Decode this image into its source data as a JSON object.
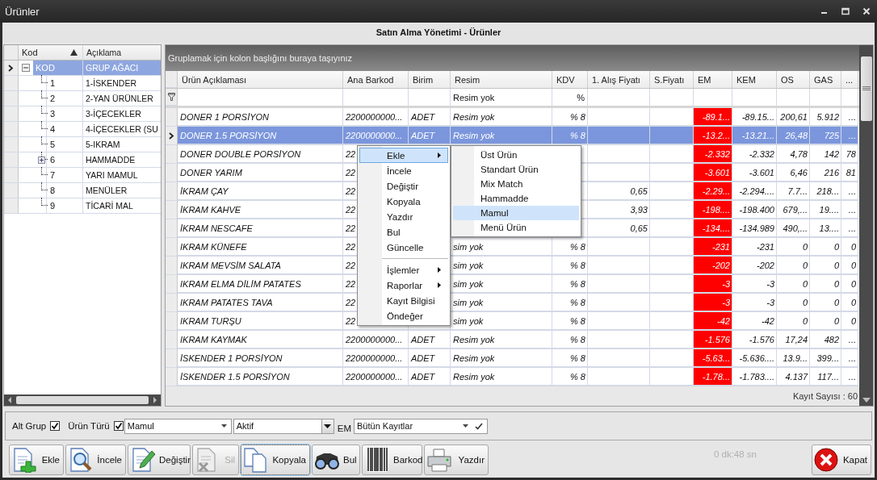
{
  "window": {
    "title": "Ürünler"
  },
  "form_title": "Satın Alma Yönetimi - Ürünler",
  "tree": {
    "columns": [
      {
        "label": "Kod",
        "sorted": true
      },
      {
        "label": "Açıklama",
        "sorted": false
      }
    ],
    "root": {
      "kod": "KOD",
      "aciklama": "GRUP AĞACI",
      "selected": true,
      "expanded": true,
      "children": [
        {
          "kod": "1",
          "aciklama": "1-İSKENDER",
          "selected": false,
          "expandable": false
        },
        {
          "kod": "2",
          "aciklama": "2-YAN ÜRÜNLER",
          "selected": false,
          "expandable": false
        },
        {
          "kod": "3",
          "aciklama": "3-İÇECEKLER",
          "selected": false,
          "expandable": false
        },
        {
          "kod": "4",
          "aciklama": "4-İÇECEKLER (SU",
          "selected": false,
          "expandable": false
        },
        {
          "kod": "5",
          "aciklama": "5-IKRAM",
          "selected": false,
          "expandable": false
        },
        {
          "kod": "6",
          "aciklama": "HAMMADDE",
          "selected": false,
          "expandable": true
        },
        {
          "kod": "7",
          "aciklama": "YARI MAMUL",
          "selected": false,
          "expandable": false
        },
        {
          "kod": "8",
          "aciklama": "MENÜLER",
          "selected": false,
          "expandable": false
        },
        {
          "kod": "9",
          "aciklama": "TİCARİ MAL",
          "selected": false,
          "expandable": false
        }
      ]
    }
  },
  "grid": {
    "group_hint": "Gruplamak için kolon başlığını buraya taşıyınız",
    "columns": [
      {
        "label": "Ürün Açıklaması",
        "kind": "text"
      },
      {
        "label": "Ana Barkod",
        "kind": "text"
      },
      {
        "label": "Birim",
        "kind": "text"
      },
      {
        "label": "Resim",
        "kind": "text",
        "filter": "Resim yok"
      },
      {
        "label": "KDV",
        "kind": "number",
        "filter": "%"
      },
      {
        "label": "1. Alış Fiyatı",
        "kind": "number"
      },
      {
        "label": "S.Fiyatı",
        "kind": "number"
      },
      {
        "label": "EM",
        "kind": "alert"
      },
      {
        "label": "KEM",
        "kind": "number"
      },
      {
        "label": "OS",
        "kind": "number"
      },
      {
        "label": "GAS",
        "kind": "number"
      },
      {
        "label": "...",
        "kind": "number"
      }
    ],
    "rows": [
      {
        "selected": false,
        "cells": [
          "DONER 1 PORSİYON",
          "2200000000...",
          "ADET",
          "Resim yok",
          "% 8",
          null,
          null,
          "-89.1...",
          "-89.15...",
          "200,61",
          "5.912",
          "..."
        ]
      },
      {
        "selected": true,
        "cells": [
          "DONER 1.5 PORSİYON",
          "2200000000...",
          "ADET",
          "Resim yok",
          "% 8",
          null,
          null,
          "-13.2...",
          "-13.21...",
          "26,48",
          "725",
          "..."
        ]
      },
      {
        "selected": false,
        "cells": [
          "DONER DOUBLE PORSİYON",
          "22",
          null,
          null,
          null,
          null,
          null,
          "-2.332",
          "-2.332",
          "4,78",
          "142",
          "78"
        ]
      },
      {
        "selected": false,
        "cells": [
          "DONER YARIM",
          "22",
          null,
          null,
          null,
          null,
          null,
          "-3.601",
          "-3.601",
          "6,46",
          "216",
          "81"
        ]
      },
      {
        "selected": false,
        "cells": [
          "İKRAM ÇAY",
          "22",
          null,
          null,
          null,
          "0,65",
          null,
          "-2.29...",
          "-2.294....",
          "7.7...",
          "218...",
          "..."
        ]
      },
      {
        "selected": false,
        "cells": [
          "İKRAM KAHVE",
          "22",
          null,
          null,
          null,
          "3,93",
          null,
          "-198....",
          "-198.400",
          "679,...",
          "19....",
          "..."
        ]
      },
      {
        "selected": false,
        "cells": [
          "İKRAM NESCAFE",
          "22",
          null,
          null,
          null,
          "0,65",
          null,
          "-134....",
          "-134.989",
          "490,...",
          "13....",
          "..."
        ]
      },
      {
        "selected": false,
        "cells": [
          "IKRAM KÜNEFE",
          "22",
          null,
          "sim yok",
          "% 8",
          null,
          null,
          "-231",
          "-231",
          "0",
          "0",
          "0"
        ]
      },
      {
        "selected": false,
        "cells": [
          "IKRAM MEVSİM SALATA",
          "22",
          null,
          "sim yok",
          "% 8",
          null,
          null,
          "-202",
          "-202",
          "0",
          "0",
          "0"
        ]
      },
      {
        "selected": false,
        "cells": [
          "IKRAM ELMA DİLİM PATATES",
          "22",
          null,
          "sim yok",
          "% 8",
          null,
          null,
          "-3",
          "-3",
          "0",
          "0",
          "0"
        ]
      },
      {
        "selected": false,
        "cells": [
          "IKRAM PATATES TAVA",
          "22",
          null,
          "sim yok",
          "% 8",
          null,
          null,
          "-3",
          "-3",
          "0",
          "0",
          "0"
        ]
      },
      {
        "selected": false,
        "cells": [
          "IKRAM TURŞU",
          "22",
          null,
          "sim yok",
          "% 8",
          null,
          null,
          "-42",
          "-42",
          "0",
          "0",
          "0"
        ]
      },
      {
        "selected": false,
        "cells": [
          "IKRAM KAYMAK",
          "2200000000...",
          "ADET",
          "Resim yok",
          "% 8",
          null,
          null,
          "-1.576",
          "-1.576",
          "17,24",
          "482",
          "..."
        ]
      },
      {
        "selected": false,
        "cells": [
          "İSKENDER 1 PORSİYON",
          "2200000000...",
          "ADET",
          "Resim yok",
          "% 8",
          null,
          null,
          "-5.63...",
          "-5.636....",
          "13.9...",
          "399...",
          "..."
        ]
      },
      {
        "selected": false,
        "cells": [
          "İSKENDER 1.5  PORSİYON",
          "2200000000...",
          "ADET",
          "Resim yok",
          "% 8",
          null,
          null,
          "-1.78...",
          "-1.783....",
          "4.137",
          "117...",
          "..."
        ]
      }
    ],
    "record_count": "Kayıt Sayısı : 60"
  },
  "context_menu": {
    "items": [
      {
        "kind": "item",
        "label": "Ekle",
        "selected": true,
        "submenu": true
      },
      {
        "kind": "item",
        "label": "İncele",
        "selected": false,
        "submenu": false
      },
      {
        "kind": "item",
        "label": "Değiştir",
        "selected": false,
        "submenu": false
      },
      {
        "kind": "item",
        "label": "Kopyala",
        "selected": false,
        "submenu": false
      },
      {
        "kind": "item",
        "label": "Yazdır",
        "selected": false,
        "submenu": false
      },
      {
        "kind": "item",
        "label": "Bul",
        "selected": false,
        "submenu": false
      },
      {
        "kind": "item",
        "label": "Güncelle",
        "selected": false,
        "submenu": false
      },
      {
        "kind": "separator"
      },
      {
        "kind": "item",
        "label": "İşlemler",
        "selected": false,
        "submenu": true
      },
      {
        "kind": "item",
        "label": "Raporlar",
        "selected": false,
        "submenu": true
      },
      {
        "kind": "item",
        "label": "Kayıt Bilgisi",
        "selected": false,
        "submenu": false
      },
      {
        "kind": "item",
        "label": "Öndeğer",
        "selected": false,
        "submenu": false
      }
    ],
    "submenu": [
      {
        "label": "Üst Ürün",
        "selected": false
      },
      {
        "label": "Standart Ürün",
        "selected": false
      },
      {
        "label": "Mix Match",
        "selected": false
      },
      {
        "label": "Hammadde",
        "selected": false
      },
      {
        "label": "Mamul",
        "selected": true
      },
      {
        "label": "Menü Ürün",
        "selected": false
      }
    ]
  },
  "filters": {
    "alt_grup": {
      "label": "Alt Grup",
      "checked": true
    },
    "urun_turu": {
      "label": "Ürün Türü",
      "checked": true
    },
    "urun_turu_value": "Mamul",
    "status_value": "Aktif",
    "em_label": "EM",
    "em_value": "Bütün Kayıtlar"
  },
  "toolbar": [
    {
      "kind": "add",
      "label": "Ekle",
      "disabled": false,
      "focused": false
    },
    {
      "kind": "view",
      "label": "İncele",
      "disabled": false,
      "focused": false
    },
    {
      "kind": "edit",
      "label": "Değiştir",
      "disabled": false,
      "focused": false
    },
    {
      "kind": "delete",
      "label": "Sil",
      "disabled": true,
      "focused": false
    },
    {
      "kind": "copy",
      "label": "Kopyala",
      "disabled": false,
      "focused": true
    },
    {
      "kind": "find",
      "label": "Bul",
      "disabled": false,
      "focused": false
    },
    {
      "kind": "barcode",
      "label": "Barkod",
      "disabled": false,
      "focused": false
    },
    {
      "kind": "print",
      "label": "Yazdır",
      "disabled": false,
      "focused": false
    }
  ],
  "timer": "0 dk:48 sn",
  "close_button": "Kapat"
}
